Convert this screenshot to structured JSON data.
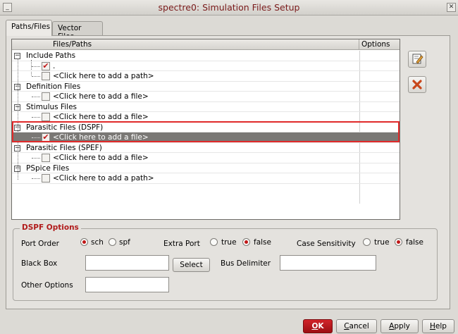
{
  "window": {
    "title": "spectre0: Simulation Files Setup",
    "minimize_glyph": "_",
    "close_glyph": "✕"
  },
  "tabs": [
    {
      "label": "Paths/Files",
      "active": true
    },
    {
      "label": "Vector Files",
      "active": false
    }
  ],
  "tree": {
    "columns": {
      "files": "Files/Paths",
      "options": "Options"
    },
    "groups": [
      {
        "label": "Include Paths",
        "children": [
          {
            "label": ".",
            "checked": true
          },
          {
            "label": "<Click here to add a path>",
            "checked": false
          }
        ]
      },
      {
        "label": "Definition Files",
        "children": [
          {
            "label": "<Click here to add a file>",
            "checked": false
          }
        ]
      },
      {
        "label": "Stimulus Files",
        "children": [
          {
            "label": "<Click here to add a file>",
            "checked": false
          }
        ]
      },
      {
        "label": "Parasitic Files (DSPF)",
        "children": [
          {
            "label": "<Click here to add a file>",
            "checked": true,
            "selected": true
          }
        ]
      },
      {
        "label": "Parasitic Files (SPEF)",
        "children": [
          {
            "label": "<Click here to add a file>",
            "checked": false
          }
        ]
      },
      {
        "label": "PSpice Files",
        "children": [
          {
            "label": "<Click here to add a path>",
            "checked": false
          }
        ]
      }
    ],
    "expander_glyph": "−",
    "check_glyph": "✔"
  },
  "side_buttons": [
    {
      "name": "edit-icon"
    },
    {
      "name": "delete-icon"
    }
  ],
  "dspf": {
    "title": "DSPF Options",
    "port_order": {
      "label": "Port Order",
      "options": [
        "sch",
        "spf"
      ],
      "selected": "sch"
    },
    "extra_port": {
      "label": "Extra Port",
      "options": [
        "true",
        "false"
      ],
      "selected": "false"
    },
    "case_sensitivity": {
      "label": "Case Sensitivity",
      "options": [
        "true",
        "false"
      ],
      "selected": "false"
    },
    "black_box": {
      "label": "Black Box",
      "value": ""
    },
    "select_button": "Select",
    "bus_delimiter": {
      "label": "Bus Delimiter",
      "value": ""
    },
    "other_options": {
      "label": "Other Options",
      "value": ""
    }
  },
  "footer": {
    "ok": {
      "prefix": "",
      "accel": "O",
      "rest": "K"
    },
    "cancel": {
      "prefix": "",
      "accel": "C",
      "rest": "ancel"
    },
    "apply": {
      "prefix": "",
      "accel": "A",
      "rest": "pply"
    },
    "help": {
      "prefix": "",
      "accel": "H",
      "rest": "elp"
    }
  },
  "colors": {
    "accent": "#c01717",
    "selection": "#7a7875",
    "highlight_box": "#e02a2a"
  }
}
